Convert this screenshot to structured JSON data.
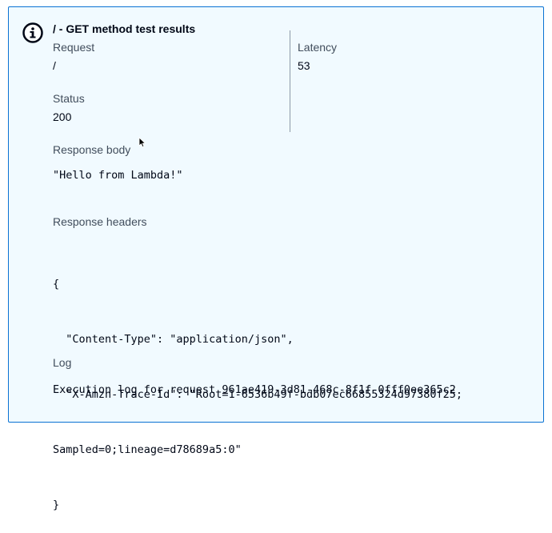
{
  "result": {
    "title": "/ - GET method test results",
    "request_label": "Request",
    "request_value": "/",
    "latency_label": "Latency",
    "latency_value": "53",
    "status_label": "Status",
    "status_value": "200",
    "response_body_label": "Response body",
    "response_body_value": "\"Hello from Lambda!\"",
    "response_headers_label": "Response headers",
    "response_headers_lines": [
      "{",
      "  \"Content-Type\": \"application/json\",",
      "  \"X-Amzn-Trace-Id\": \"Root=1-6536b49f-bdb07ec66855324d97380f25;",
      "Sampled=0;lineage=d78689a5:0\"",
      "}"
    ],
    "log_label": "Log",
    "log_value": "Execution log for request 961ae419-3d81-468c-8f1f-0fff0ee365c2"
  },
  "icons": {
    "info": "info-icon",
    "cursor": "mouse-cursor-icon"
  },
  "colors": {
    "accent": "#0972d3",
    "panel_bg": "#f1faff"
  }
}
